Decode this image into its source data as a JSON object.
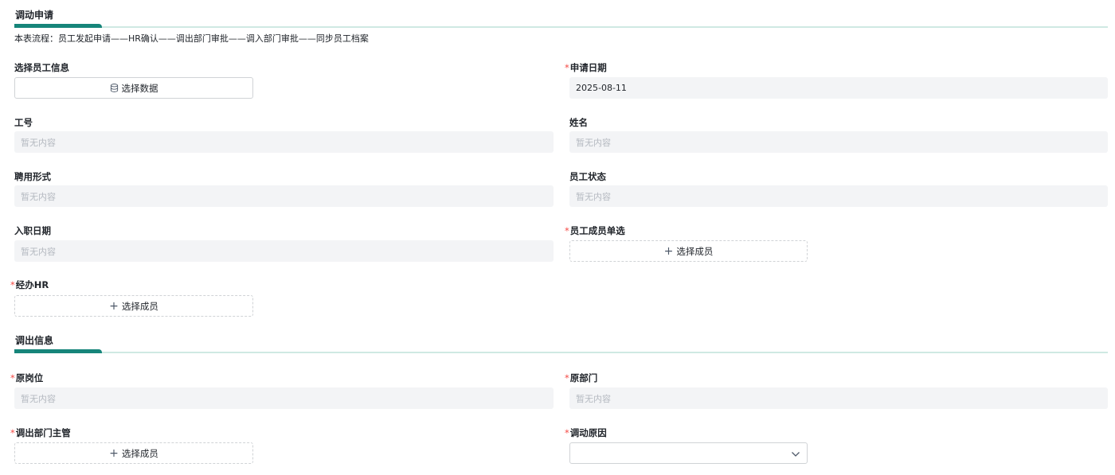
{
  "sections": {
    "transfer_apply": {
      "title": "调动申请"
    },
    "transfer_out": {
      "title": "调出信息"
    }
  },
  "process_desc": "本表流程：员工发起申请——HR确认——调出部门审批——调入部门审批——同步员工档案",
  "fields": {
    "select_employee": {
      "label": "选择员工信息",
      "button": "选择数据"
    },
    "apply_date": {
      "label": "申请日期",
      "value": "2025-08-11"
    },
    "employee_no": {
      "label": "工号",
      "placeholder": "暂无内容"
    },
    "name": {
      "label": "姓名",
      "placeholder": "暂无内容"
    },
    "employment_type": {
      "label": "聘用形式",
      "placeholder": "暂无内容"
    },
    "employee_status": {
      "label": "员工状态",
      "placeholder": "暂无内容"
    },
    "hire_date": {
      "label": "入职日期",
      "placeholder": "暂无内容"
    },
    "member_single": {
      "label": "员工成员单选",
      "button": "选择成员"
    },
    "handler_hr": {
      "label": "经办HR",
      "button": "选择成员"
    },
    "original_position": {
      "label": "原岗位",
      "placeholder": "暂无内容"
    },
    "original_dept": {
      "label": "原部门",
      "placeholder": "暂无内容"
    },
    "out_dept_manager": {
      "label": "调出部门主管",
      "button": "选择成员"
    },
    "transfer_reason": {
      "label": "调动原因",
      "value": ""
    }
  },
  "required_mark": "*",
  "icons": {
    "select_data": "database-icon",
    "add_member": "plus-icon",
    "dropdown": "chevron-down-icon"
  },
  "colors": {
    "accent": "#16857a",
    "track": "#cfe9e3",
    "required": "#f54a45",
    "readonly_bg": "#f3f4f6",
    "placeholder": "#b4b9c0"
  }
}
